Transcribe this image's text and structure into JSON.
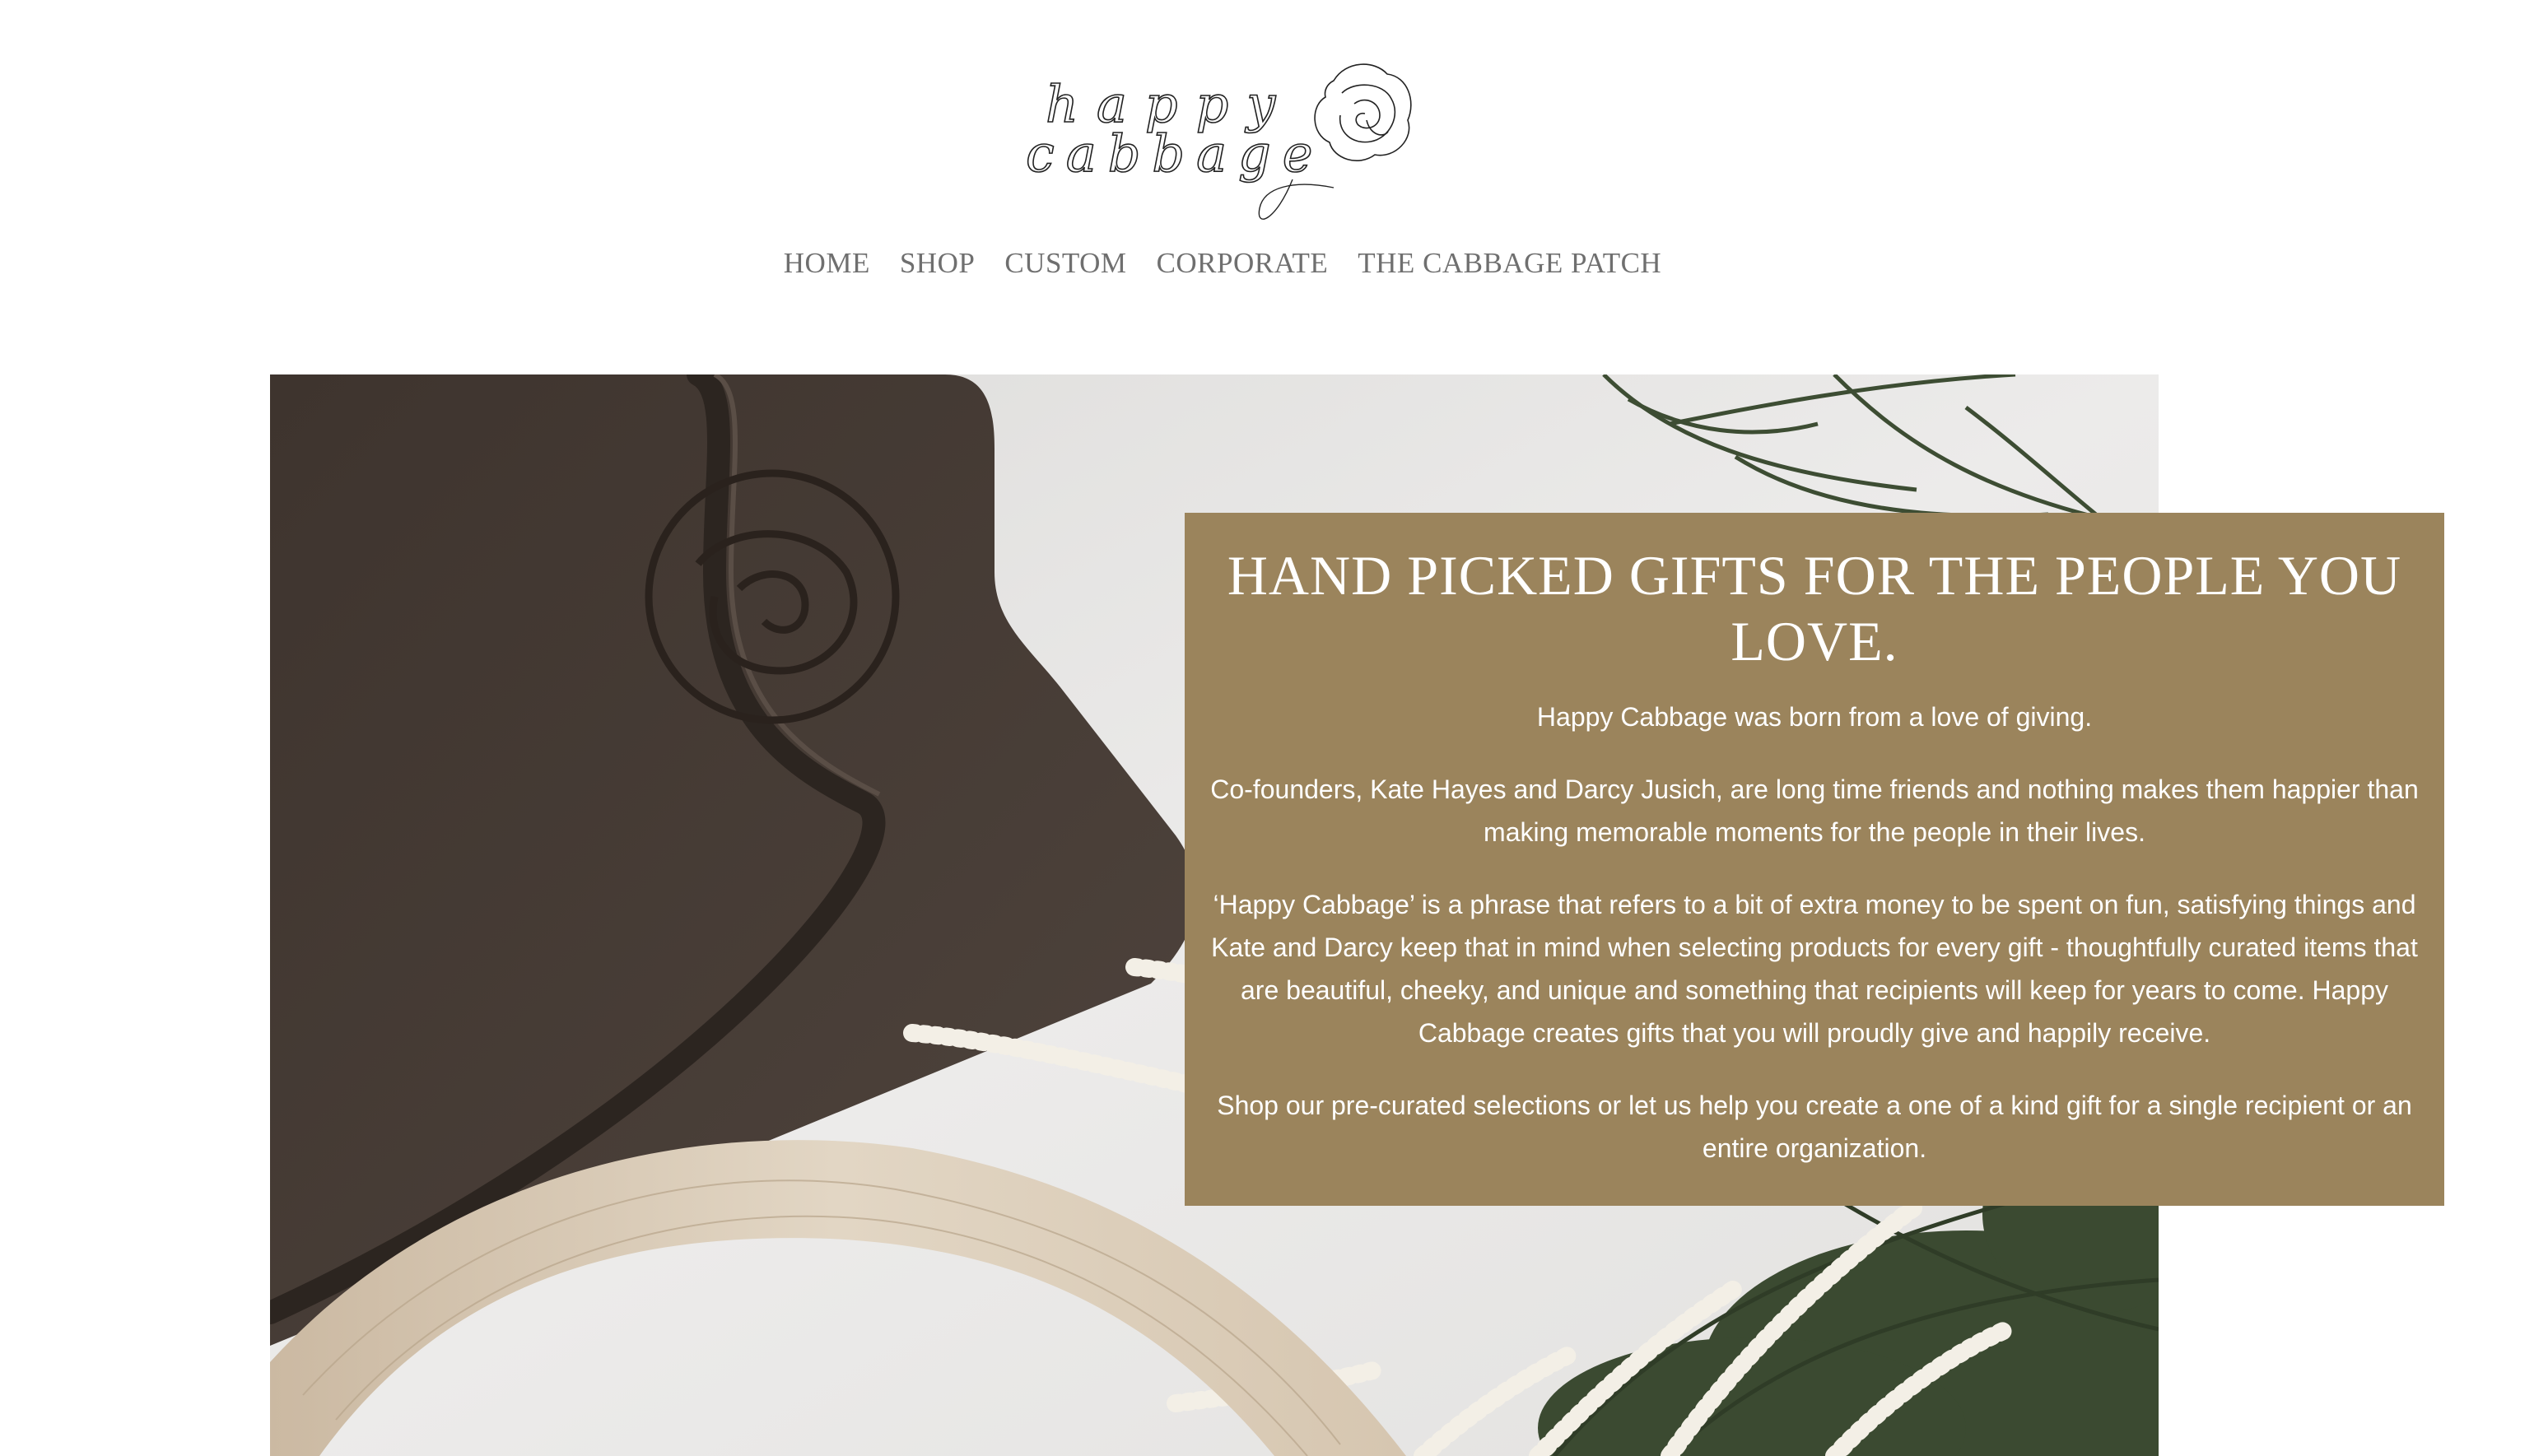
{
  "brand": {
    "logo_line1": "happy",
    "logo_line2": "cabbage",
    "logo_icon": "cabbage-flower-icon"
  },
  "nav": {
    "items": [
      {
        "label": "HOME"
      },
      {
        "label": "SHOP"
      },
      {
        "label": "CUSTOM"
      },
      {
        "label": "CORPORATE"
      },
      {
        "label": "THE CABBAGE PATCH"
      }
    ]
  },
  "hero": {
    "image": "gift-cutting-board-with-ribbon-and-greenery-photo"
  },
  "about": {
    "title": "HAND PICKED GIFTS FOR THE PEOPLE YOU LOVE.",
    "paragraphs": [
      "Happy Cabbage was born from a love of giving.",
      "Co-founders, Kate Hayes and Darcy Jusich, are long time friends and nothing makes them happier than making memorable moments for the people in their lives.",
      "‘Happy Cabbage’ is a phrase that refers to a bit of extra money to be spent on fun, satisfying things and Kate and Darcy keep that in mind when selecting products for every gift - thoughtfully curated items that are beautiful, cheeky, and unique and something that recipients will keep for years to come. Happy Cabbage creates gifts that you will proudly give and happily receive.",
      "Shop our pre-curated selections or let us help you create a one of a kind gift for a single recipient or an entire organization."
    ]
  },
  "colors": {
    "panel_bg": "#9b845c",
    "nav_text": "#6f6f6f",
    "board": "#4a3f38",
    "greenery": "#3d4d33"
  }
}
